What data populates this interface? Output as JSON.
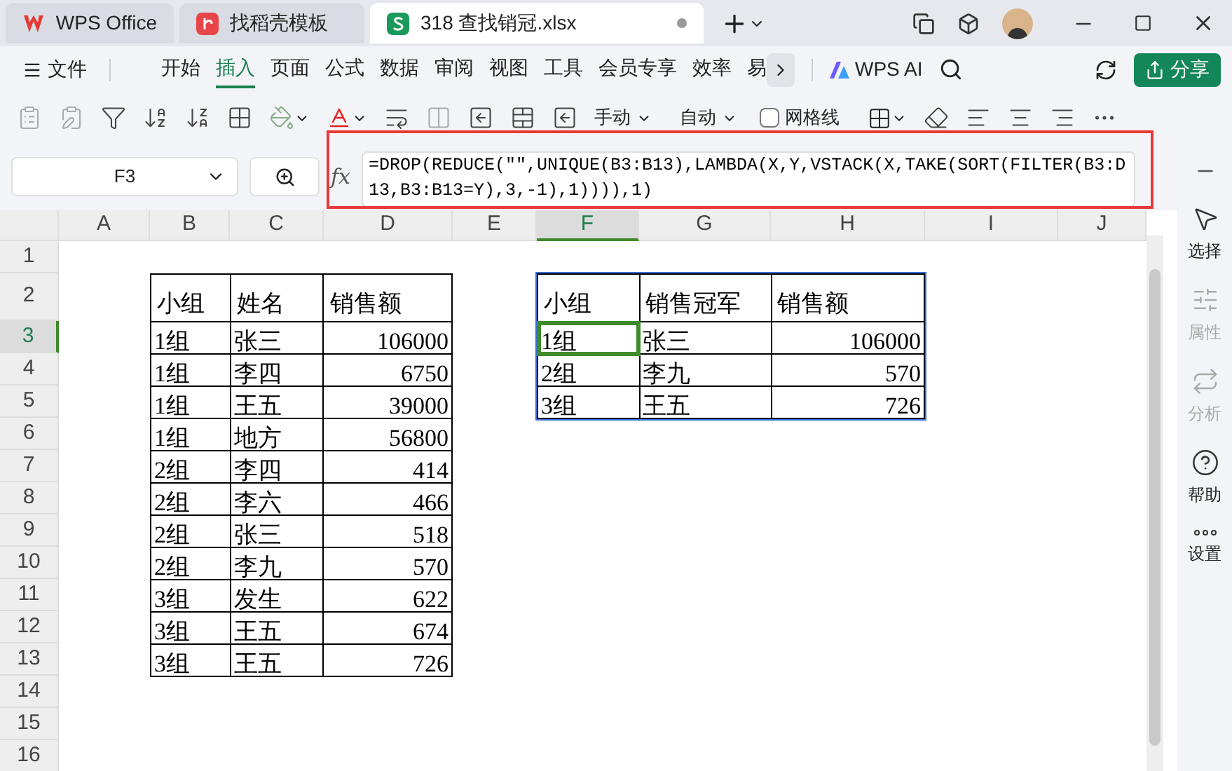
{
  "tabs": [
    {
      "label": "WPS Office",
      "kind": "wps",
      "selected": false
    },
    {
      "label": "找稻壳模板",
      "kind": "template",
      "selected": false
    },
    {
      "label": "318 查找销冠.xlsx",
      "kind": "sheet",
      "selected": true
    }
  ],
  "menu": {
    "file_label": "文件",
    "items": [
      {
        "label": "开始",
        "selected": false
      },
      {
        "label": "插入",
        "selected": true
      },
      {
        "label": "页面",
        "selected": false
      },
      {
        "label": "公式",
        "selected": false
      },
      {
        "label": "数据",
        "selected": false
      },
      {
        "label": "审阅",
        "selected": false
      },
      {
        "label": "视图",
        "selected": false
      },
      {
        "label": "工具",
        "selected": false
      },
      {
        "label": "会员专享",
        "selected": false
      },
      {
        "label": "效率",
        "selected": false
      },
      {
        "label": "易",
        "selected": false
      }
    ],
    "ai_label": "WPS AI",
    "share_label": "分享"
  },
  "toolbar": {
    "row_height_label": "手动",
    "col_width_label": "自动",
    "gridlines": {
      "label": "网格线",
      "checked": false
    }
  },
  "formula_bar": {
    "cell_ref": "F3",
    "fx": "fx",
    "formula": "=DROP(REDUCE(\"\",UNIQUE(B3:B13),LAMBDA(X,Y,VSTACK(X,TAKE(SORT(FILTER(B3:D13,B3:B13=Y),3,-1),1)))),1)"
  },
  "sheet": {
    "columns": [
      {
        "label": "A",
        "selected": false
      },
      {
        "label": "B",
        "selected": false
      },
      {
        "label": "C",
        "selected": false
      },
      {
        "label": "D",
        "selected": false
      },
      {
        "label": "E",
        "selected": false
      },
      {
        "label": "F",
        "selected": true
      },
      {
        "label": "G",
        "selected": false
      },
      {
        "label": "H",
        "selected": false
      },
      {
        "label": "I",
        "selected": false
      },
      {
        "label": "J",
        "selected": false
      }
    ],
    "rows": [
      {
        "label": "1",
        "selected": false
      },
      {
        "label": "2",
        "selected": false
      },
      {
        "label": "3",
        "selected": true
      },
      {
        "label": "4",
        "selected": false
      },
      {
        "label": "5",
        "selected": false
      },
      {
        "label": "6",
        "selected": false
      },
      {
        "label": "7",
        "selected": false
      },
      {
        "label": "8",
        "selected": false
      },
      {
        "label": "9",
        "selected": false
      },
      {
        "label": "10",
        "selected": false
      },
      {
        "label": "11",
        "selected": false
      },
      {
        "label": "12",
        "selected": false
      },
      {
        "label": "13",
        "selected": false
      },
      {
        "label": "14",
        "selected": false
      },
      {
        "label": "15",
        "selected": false
      },
      {
        "label": "16",
        "selected": false
      }
    ],
    "tables": [
      {
        "selected": false,
        "headers": [
          {
            "label": "小组",
            "kind": "text"
          },
          {
            "label": "姓名",
            "kind": "text"
          },
          {
            "label": "销售额",
            "kind": "number"
          }
        ],
        "rows": [
          [
            {
              "text": "1组",
              "selected": false
            },
            {
              "text": "张三",
              "selected": false
            },
            {
              "text": "106000",
              "selected": false
            }
          ],
          [
            {
              "text": "1组",
              "selected": false
            },
            {
              "text": "李四",
              "selected": false
            },
            {
              "text": "6750",
              "selected": false
            }
          ],
          [
            {
              "text": "1组",
              "selected": false
            },
            {
              "text": "王五",
              "selected": false
            },
            {
              "text": "39000",
              "selected": false
            }
          ],
          [
            {
              "text": "1组",
              "selected": false
            },
            {
              "text": "地方",
              "selected": false
            },
            {
              "text": "56800",
              "selected": false
            }
          ],
          [
            {
              "text": "2组",
              "selected": false
            },
            {
              "text": "李四",
              "selected": false
            },
            {
              "text": "414",
              "selected": false
            }
          ],
          [
            {
              "text": "2组",
              "selected": false
            },
            {
              "text": "李六",
              "selected": false
            },
            {
              "text": "466",
              "selected": false
            }
          ],
          [
            {
              "text": "2组",
              "selected": false
            },
            {
              "text": "张三",
              "selected": false
            },
            {
              "text": "518",
              "selected": false
            }
          ],
          [
            {
              "text": "2组",
              "selected": false
            },
            {
              "text": "李九",
              "selected": false
            },
            {
              "text": "570",
              "selected": false
            }
          ],
          [
            {
              "text": "3组",
              "selected": false
            },
            {
              "text": "发生",
              "selected": false
            },
            {
              "text": "622",
              "selected": false
            }
          ],
          [
            {
              "text": "3组",
              "selected": false
            },
            {
              "text": "王五",
              "selected": false
            },
            {
              "text": "674",
              "selected": false
            }
          ],
          [
            {
              "text": "3组",
              "selected": false
            },
            {
              "text": "王五",
              "selected": false
            },
            {
              "text": "726",
              "selected": false
            }
          ]
        ]
      },
      {
        "selected": true,
        "headers": [
          {
            "label": "小组",
            "kind": "text"
          },
          {
            "label": "销售冠军",
            "kind": "text"
          },
          {
            "label": "销售额",
            "kind": "number"
          }
        ],
        "rows": [
          [
            {
              "text": "1组",
              "selected": true
            },
            {
              "text": "张三",
              "selected": false
            },
            {
              "text": "106000",
              "selected": false
            }
          ],
          [
            {
              "text": "2组",
              "selected": false
            },
            {
              "text": "李九",
              "selected": false
            },
            {
              "text": "570",
              "selected": false
            }
          ],
          [
            {
              "text": "3组",
              "selected": false
            },
            {
              "text": "王五",
              "selected": false
            },
            {
              "text": "726",
              "selected": false
            }
          ]
        ]
      }
    ]
  },
  "sidebar": [
    {
      "label": "选择",
      "kind": "select",
      "disabled": false
    },
    {
      "label": "属性",
      "kind": "properties",
      "disabled": true
    },
    {
      "label": "分析",
      "kind": "analyze",
      "disabled": true
    },
    {
      "label": "帮助",
      "kind": "help",
      "disabled": false
    },
    {
      "label": "设置",
      "kind": "settings",
      "disabled": false
    }
  ]
}
